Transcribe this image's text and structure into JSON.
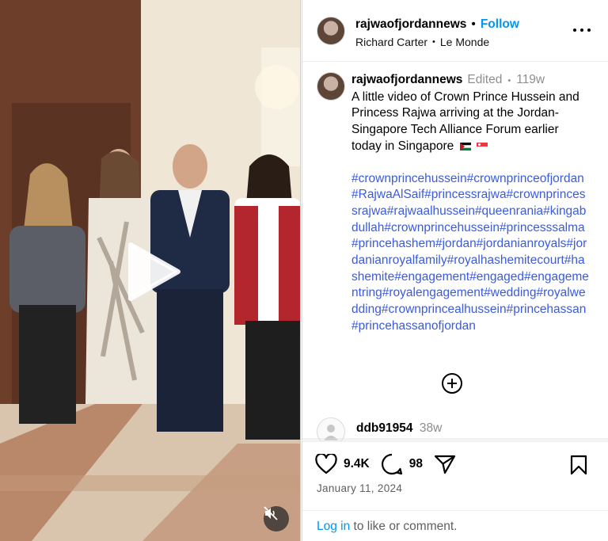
{
  "post": {
    "author": "rajwaofjordannews",
    "follow_label": "Follow",
    "header_dot": "•",
    "credit_name": "Richard Carter",
    "credit_sep": "•",
    "credit_source": "Le Monde"
  },
  "caption": {
    "author": "rajwaofjordannews",
    "edited_label": "Edited",
    "sep": "•",
    "age": "119w",
    "text": "A little video of Crown Prince Hussein and Princess Rajwa arriving at the Jordan-Singapore Tech Alliance Forum earlier today in Singapore",
    "hashtags": "#crownprincehussein#crownprinceofjordan#RajwaAlSaif#princessrajwa#crownprincessrajwa#rajwaalhussein#queenrania#kingabdullah#crownprincehussein#princesssalma#princehashem#jordan#jordanianroyals#jordanianroyalfamily#royalhashemitecourt#hashemite#engagement#engaged#engagementring#royalengagement#wedding#royalwedding#crownprincealhussein#princehassan#princehassanofjordan"
  },
  "comment": {
    "author": "ddb91954",
    "age": "38w"
  },
  "stats": {
    "likes": "9.4K",
    "comments": "98",
    "date": "January 11, 2024"
  },
  "login": {
    "link_label": "Log in",
    "text": " to like or comment."
  },
  "icons": {
    "like": "heart-icon",
    "comment": "speech-bubble-icon",
    "share": "paper-plane-icon",
    "save": "bookmark-icon",
    "more": "ellipsis-icon",
    "play": "play-icon",
    "mute": "speaker-muted-icon",
    "load_more": "plus-circle-icon"
  },
  "colors": {
    "link_blue": "#0095f6",
    "hashtag_blue": "#3b5bdb",
    "muted_text": "#8e8e8e"
  }
}
